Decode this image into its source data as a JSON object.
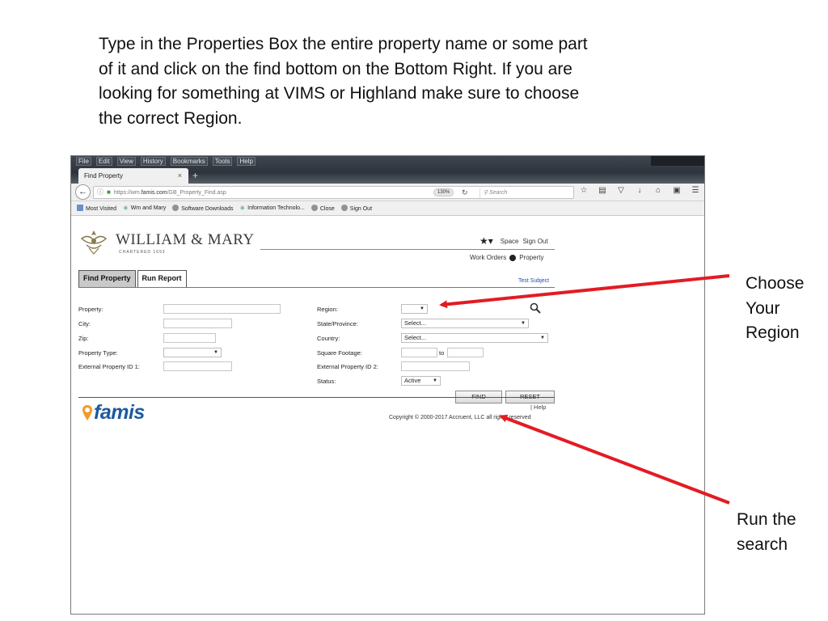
{
  "instructions": [
    "Type in the Properties Box the entire property name or some part",
    "of it and click on the find bottom on the Bottom Right.  If you are",
    "looking for something at VIMS or Highland make sure to choose",
    "the correct Region."
  ],
  "callouts": {
    "region": [
      "Choose",
      "Your",
      "Region"
    ],
    "search": [
      "Run the",
      "search"
    ],
    "arrow_color": "#e31b23"
  },
  "browser": {
    "menu": [
      "File",
      "Edit",
      "View",
      "History",
      "Bookmarks",
      "Tools",
      "Help"
    ],
    "tab_title": "Find Property",
    "tab_close": "×",
    "new_tab": "+",
    "url_prefix": "https://wm.",
    "url_domain": "famis.com",
    "url_path": "/GB_Property_Find.asp",
    "zoom": "130%",
    "search_placeholder": "Search",
    "bookmarks": [
      "Most Visited",
      "Wm and Mary",
      "Software Downloads",
      "Information Technolo...",
      "Close",
      "Sign Out"
    ]
  },
  "app": {
    "brand_name": "WILLIAM & MARY",
    "brand_sub": "CHARTERED 1693",
    "nav": {
      "space": "Space",
      "sign_out": "Sign Out",
      "work_orders": "Work Orders",
      "property": "Property"
    },
    "tabs": [
      "Find Property",
      "Run Report"
    ],
    "test_subject": "Test Subject",
    "form": {
      "property_label": "Property:",
      "city_label": "City:",
      "zip_label": "Zip:",
      "property_type_label": "Property Type:",
      "ext_id1_label": "External Property ID 1:",
      "region_label": "Region:",
      "state_label": "State/Province:",
      "country_label": "Country:",
      "sqft_label": "Square Footage:",
      "ext_id2_label": "External Property ID 2:",
      "status_label": "Status:",
      "state_value": "Select...",
      "country_value": "Select...",
      "status_value": "Active",
      "to_label": "to"
    },
    "buttons": {
      "find": "FIND",
      "reset": "RESET"
    },
    "footer": {
      "logo_text": "famis",
      "help": "|   Help",
      "copyright": "Copyright © 2000-2017 Accruent, LLC all rights reserved"
    }
  }
}
